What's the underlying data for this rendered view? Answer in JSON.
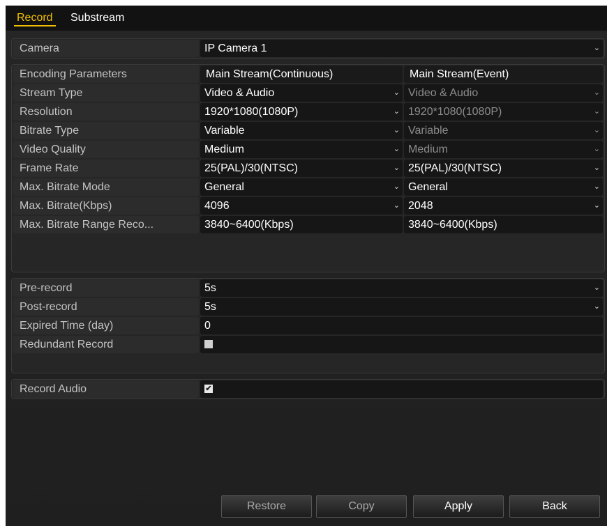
{
  "tabs": {
    "record": "Record",
    "substream": "Substream"
  },
  "camera": {
    "label": "Camera",
    "value": "IP Camera 1"
  },
  "encoding": {
    "label": "Encoding Parameters",
    "col1_header": "Main Stream(Continuous)",
    "col2_header": "Main Stream(Event)",
    "rows": [
      {
        "label": "Stream Type",
        "v1": "Video & Audio",
        "v2": "Video & Audio"
      },
      {
        "label": "Resolution",
        "v1": "1920*1080(1080P)",
        "v2": "1920*1080(1080P)"
      },
      {
        "label": "Bitrate Type",
        "v1": "Variable",
        "v2": "Variable"
      },
      {
        "label": "Video Quality",
        "v1": "Medium",
        "v2": "Medium"
      },
      {
        "label": "Frame Rate",
        "v1": "25(PAL)/30(NTSC)",
        "v2": "25(PAL)/30(NTSC)"
      },
      {
        "label": "Max. Bitrate Mode",
        "v1": "General",
        "v2": "General"
      },
      {
        "label": "Max. Bitrate(Kbps)",
        "v1": "4096",
        "v2": "2048"
      },
      {
        "label": "Max. Bitrate Range Reco...",
        "v1": "3840~6400(Kbps)",
        "v2": "3840~6400(Kbps)"
      }
    ]
  },
  "record": {
    "pre_label": "Pre-record",
    "pre_value": "5s",
    "post_label": "Post-record",
    "post_value": "5s",
    "expired_label": "Expired Time (day)",
    "expired_value": "0",
    "redundant_label": "Redundant Record",
    "redundant_checked": false
  },
  "audio": {
    "label": "Record Audio",
    "checked": true,
    "check_glyph": "✔"
  },
  "arrow_glyph": "⌄",
  "buttons": {
    "restore": "Restore",
    "copy": "Copy",
    "apply": "Apply",
    "back": "Back"
  }
}
